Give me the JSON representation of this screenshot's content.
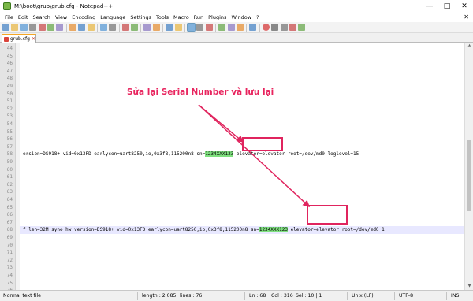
{
  "window": {
    "title": "M:\\boot\\grub\\grub.cfg - Notepad++",
    "min_label": "—",
    "max_label": "□",
    "close_label": "✕"
  },
  "menu": {
    "items": [
      "File",
      "Edit",
      "Search",
      "View",
      "Encoding",
      "Language",
      "Settings",
      "Tools",
      "Macro",
      "Run",
      "Plugins",
      "Window",
      "?"
    ],
    "close_glyph": "✕"
  },
  "toolbar": {
    "icons": [
      "new-file",
      "open-file",
      "save",
      "save-all",
      "close",
      "close-all",
      "print",
      "sep",
      "cut",
      "copy",
      "paste",
      "sep",
      "undo",
      "redo",
      "sep",
      "find",
      "replace",
      "sep",
      "zoom-in",
      "zoom-out",
      "sep",
      "sync-vertical",
      "sync-horizontal",
      "sep",
      "word-wrap",
      "all-chars",
      "indent-guide",
      "sep",
      "doc-map",
      "function-list",
      "folder-workspace",
      "sep",
      "monitor",
      "sep",
      "record-macro",
      "stop-macro",
      "play-macro",
      "run-macro",
      "save-macro"
    ]
  },
  "tab": {
    "label": "grub.cfg",
    "close_glyph": "✕"
  },
  "editor": {
    "lines": [
      {
        "num": "44",
        "text": ""
      },
      {
        "num": "45",
        "text": ""
      },
      {
        "num": "46",
        "text": ""
      },
      {
        "num": "47",
        "text": ""
      },
      {
        "num": "48",
        "text": ""
      },
      {
        "num": "49",
        "text": ""
      },
      {
        "num": "50",
        "text": ""
      },
      {
        "num": "51",
        "text": ""
      },
      {
        "num": "52",
        "text": ""
      },
      {
        "num": "53",
        "text": ""
      },
      {
        "num": "54",
        "text": ""
      },
      {
        "num": "55",
        "text": ""
      },
      {
        "num": "56",
        "text": ""
      },
      {
        "num": "57",
        "text": ""
      },
      {
        "num": "58",
        "text": "ersion=DS918+ vid=0x13FD earlycon=uart8250,io,0x3f8,115200n8 sn=",
        "hl": "1234XXX123",
        "after": " elevator=elevator root=/dev/md0 loglevel=15"
      },
      {
        "num": "59",
        "text": ""
      },
      {
        "num": "60",
        "text": ""
      },
      {
        "num": "61",
        "text": ""
      },
      {
        "num": "62",
        "text": ""
      },
      {
        "num": "63",
        "text": ""
      },
      {
        "num": "64",
        "text": ""
      },
      {
        "num": "65",
        "text": ""
      },
      {
        "num": "66",
        "text": ""
      },
      {
        "num": "67",
        "text": ""
      },
      {
        "num": "68",
        "text": "f_len=32M syno_hw_version=DS918+ vid=0x13FD earlycon=uart8250,io,0x3f8,115200n8 sn=",
        "hl": "1234XXX123",
        "after": " elevator=elevator root=/dev/md0 1",
        "current": true
      },
      {
        "num": "69",
        "text": ""
      },
      {
        "num": "70",
        "text": ""
      },
      {
        "num": "71",
        "text": ""
      },
      {
        "num": "72",
        "text": ""
      },
      {
        "num": "73",
        "text": ""
      },
      {
        "num": "74",
        "text": ""
      },
      {
        "num": "75",
        "text": ""
      },
      {
        "num": "76",
        "text": ""
      }
    ]
  },
  "annotation": {
    "callout_text": "Sửa lại Serial Number và lưu lại",
    "color": "#e0245e"
  },
  "status": {
    "file_type": "Normal text file",
    "length": "length : 2,085",
    "lines": "lines : 76",
    "ln": "Ln : 68",
    "col": "Col : 316",
    "sel": "Sel : 10 | 1",
    "eol": "Unix (LF)",
    "encoding": "UTF-8",
    "mode": "INS"
  },
  "colors": {
    "highlight_green": "#7fe07f",
    "tab_accent": "#f5a623",
    "gutter": "#e4e4e4",
    "current_line": "#e8e8ff"
  }
}
